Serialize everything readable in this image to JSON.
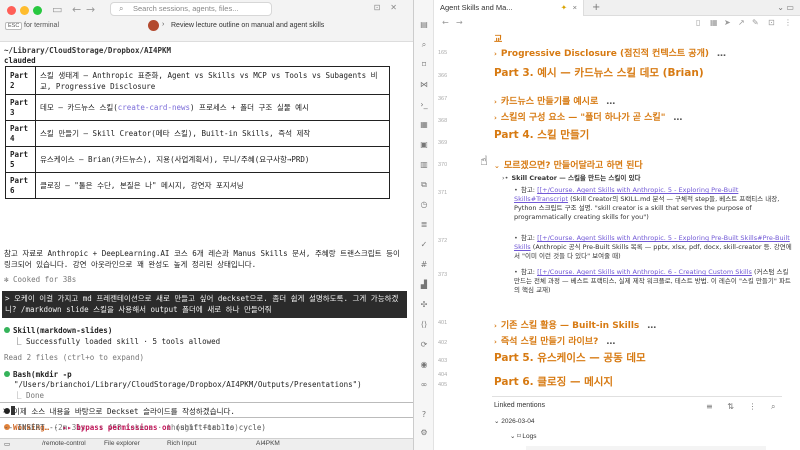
{
  "terminal": {
    "search_placeholder": "Search sessions, agents, files...",
    "esc_label": "ESC",
    "tab_terminal": "for terminal",
    "tab_title": "Review lecture outline on manual and agent skills",
    "path": "~/Library/CloudStorage/Dropbox/AI4PKM",
    "user": "clauded",
    "table_rows": [
      {
        "part": "Part 2",
        "desc": "스킬 생태계 — Anthropic 표준화, Agent vs Skills vs MCP vs Tools vs Subagents 비교, Progressive Disclosure",
        "link": ""
      },
      {
        "part": "Part 3",
        "desc": "데모 — 카드뉴스 스킬(",
        "link": "create-card-news",
        "desc_after": ") 프로세스 + 폴더 구조 실물 예시"
      },
      {
        "part": "Part 4",
        "desc": "스킬 만들기 — Skill Creator(메타 스킬), Built-in Skills, 즉석 제작",
        "link": ""
      },
      {
        "part": "Part 5",
        "desc": "유스케이스 — Brian(카드뉴스), 지용(사업계획서), 무니/주혜(요구사항→PRD)",
        "link": ""
      },
      {
        "part": "Part 6",
        "desc": "클로징 — \"툴은 수단, 본질은 나\" 메시지, 강연자 포지셔닝",
        "link": ""
      }
    ],
    "reference": "참고 자료로 Anthropic + DeepLearning.AI 코스 6개 레슨과 Manus Skills 문서, 주혜랑 트랜스크립트 등이 링크되어 있습니다. 강연 아웃라인으로 꽤 완성도 높게 정리된 상태입니다.",
    "cooked": "Cooked for 38s",
    "user_message": "오케이 이걸 가지고 md 프레젠테이션으로 새로 만들고 싶어 deckset으로. 좀더 쉽게 설명하도록. 그게 가능하겠니? /markdown slide 스킬을 사용해서 output 폴더에 새로 하나 만들어줘",
    "skill_call": "Skill(markdown-slides)",
    "skill_result": "Successfully loaded skill · 5 tools allowed",
    "read_files": "Read 2 files (ctrl+o to expand)",
    "bash_call": "Bash(mkdir -p",
    "bash_arg": "\"/Users/brianchoi/Library/CloudStorage/Dropbox/AI4PKM/Outputs/Presentations\")",
    "bash_done": "Done",
    "assistant_text": "이제 소스 내용을 바탕으로 Deckset 슬라이드를 작성하겠습니다.",
    "working": "Working…",
    "working_stats": "(2m 31s · ↓ 468 tokens · thought for 11s)",
    "prompt_char": ">",
    "insert_mode": "-- INSERT --",
    "bypass": "▸▸ bypass permissions on",
    "bypass_hint": "(shift+tab to cycle)",
    "status_items": [
      "/remote-control",
      "File explorer",
      "Rich Input",
      "AI4PKM"
    ]
  },
  "notes": {
    "tab_title": "Agent Skills and Ma...",
    "gutter_numbers": [
      "165",
      "366",
      "367",
      "368",
      "369",
      "370",
      "371",
      "372",
      "373",
      "401",
      "402",
      "403",
      "404",
      "405"
    ],
    "headings": [
      {
        "text": "교",
        "size": "mid",
        "dots": ""
      },
      {
        "text": "Progressive Disclosure (점진적 컨텍스트 공개)",
        "size": "mid",
        "dots": "…"
      },
      {
        "text": "Part 3. 예시 — 카드뉴스 스킬 데모 (Brian)",
        "size": "big",
        "dots": ""
      },
      {
        "text": "카드뉴스 만들기를 예시로",
        "size": "mid",
        "dots": "…"
      },
      {
        "text": "스킬의 구성 요소 — \"폴더 하나가 곧 스킬\"",
        "size": "mid",
        "dots": "…"
      },
      {
        "text": "Part 4. 스킬 만들기",
        "size": "big",
        "dots": ""
      },
      {
        "text": "모르겠으면? 만들어달라고 하면 된다",
        "size": "mid",
        "dots": ""
      },
      {
        "text": "기존 스킬 활용 — Built-in Skills",
        "size": "mid",
        "dots": "…"
      },
      {
        "text": "즉석 스킬 만들기 라이브?",
        "size": "mid",
        "dots": "…"
      },
      {
        "text": "Part 5. 유스케이스 — 공동 데모",
        "size": "big",
        "dots": ""
      },
      {
        "text": "Part 6. 클로징 — 메시지",
        "size": "big",
        "dots": ""
      }
    ],
    "skill_creator_line": "Skill Creator — 스킬을 만드는 스킬이 있다",
    "ref1_label": "참고:",
    "ref1_link": "[[+/Course. Agent Skills with Anthropic. 5 - Exploring Pre-Built Skills#Transcript",
    "ref1_text": "(Skill Creator의 SKILL.md 분석 — 구체적 step들, 베스트 프랙티스 내장, Python 스크립트 구조 설명. \"skill creator is a skill that serves the purpose of programmatically creating skills for you\")",
    "ref2_label": "참고:",
    "ref2_link": "[[+/Course. Agent Skills with Anthropic. 5 - Exploring Pre-Built Skills#Pre-Built Skills",
    "ref2_text": "(Anthropic 공식 Pre-Built Skills 목록 — pptx, xlsx, pdf, docx, skill-creator 등. 강연에서 \"이미 이런 것들 다 있다\" 보여줄 때)",
    "ref3_label": "참고:",
    "ref3_link": "[[+/Course. Agent Skills with Anthropic. 6 - Creating Custom Skills",
    "ref3_text": "(커스텀 스킬 만드는 전체 과정 — 베스트 프랙티스, 실제 제작 워크플로, 테스트 방법. 이 레슨이 \"스킬 만들기\" 파트의 핵심 교재)",
    "linked_mentions": "Linked mentions",
    "lm_date": "2026-03-04",
    "lm_logs": "Logs"
  }
}
